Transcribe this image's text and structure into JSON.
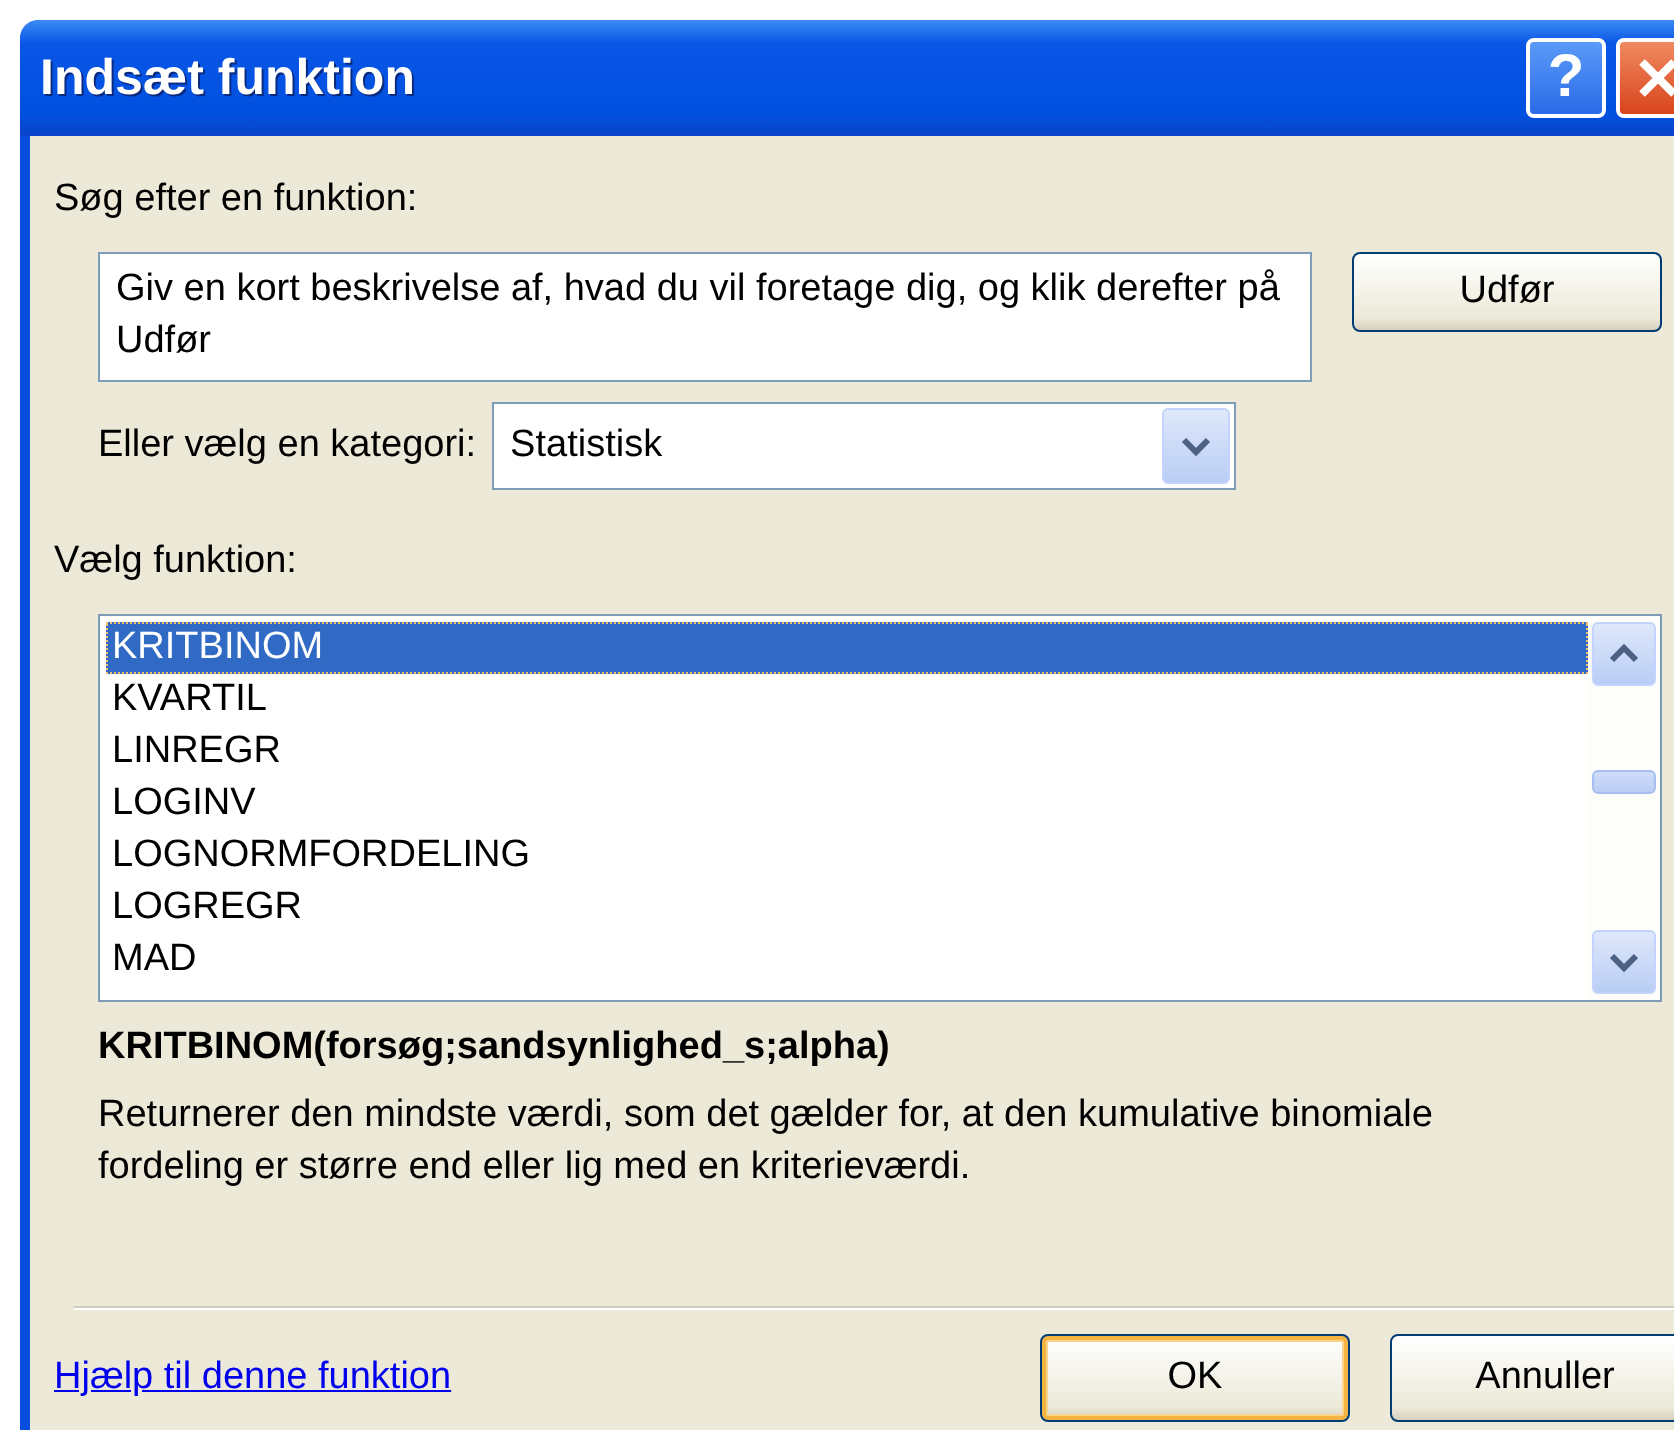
{
  "window": {
    "title": "Indsæt funktion",
    "help_button": "?"
  },
  "search": {
    "label": "Søg efter en funktion:",
    "value": "Giv en kort beskrivelse af, hvad du vil foretage dig, og klik derefter på Udfør",
    "button": "Udfør"
  },
  "category": {
    "label": "Eller vælg en kategori:",
    "value": "Statistisk"
  },
  "function_list": {
    "label": "Vælg funktion:",
    "items": [
      {
        "name": "KRITBINOM",
        "selected": true
      },
      {
        "name": "KVARTIL",
        "selected": false
      },
      {
        "name": "LINREGR",
        "selected": false
      },
      {
        "name": "LOGINV",
        "selected": false
      },
      {
        "name": "LOGNORMFORDELING",
        "selected": false
      },
      {
        "name": "LOGREGR",
        "selected": false
      },
      {
        "name": "MAD",
        "selected": false
      }
    ]
  },
  "signature": "KRITBINOM(forsøg;sandsynlighed_s;alpha)",
  "description": "Returnerer den mindste værdi, som det gælder for, at den kumulative binomiale fordeling er større end eller lig med en kriterieværdi.",
  "help_link": "Hjælp til denne funktion",
  "buttons": [
    {
      "label": "OK",
      "default": true
    },
    {
      "label": "Annuller",
      "default": false
    }
  ]
}
